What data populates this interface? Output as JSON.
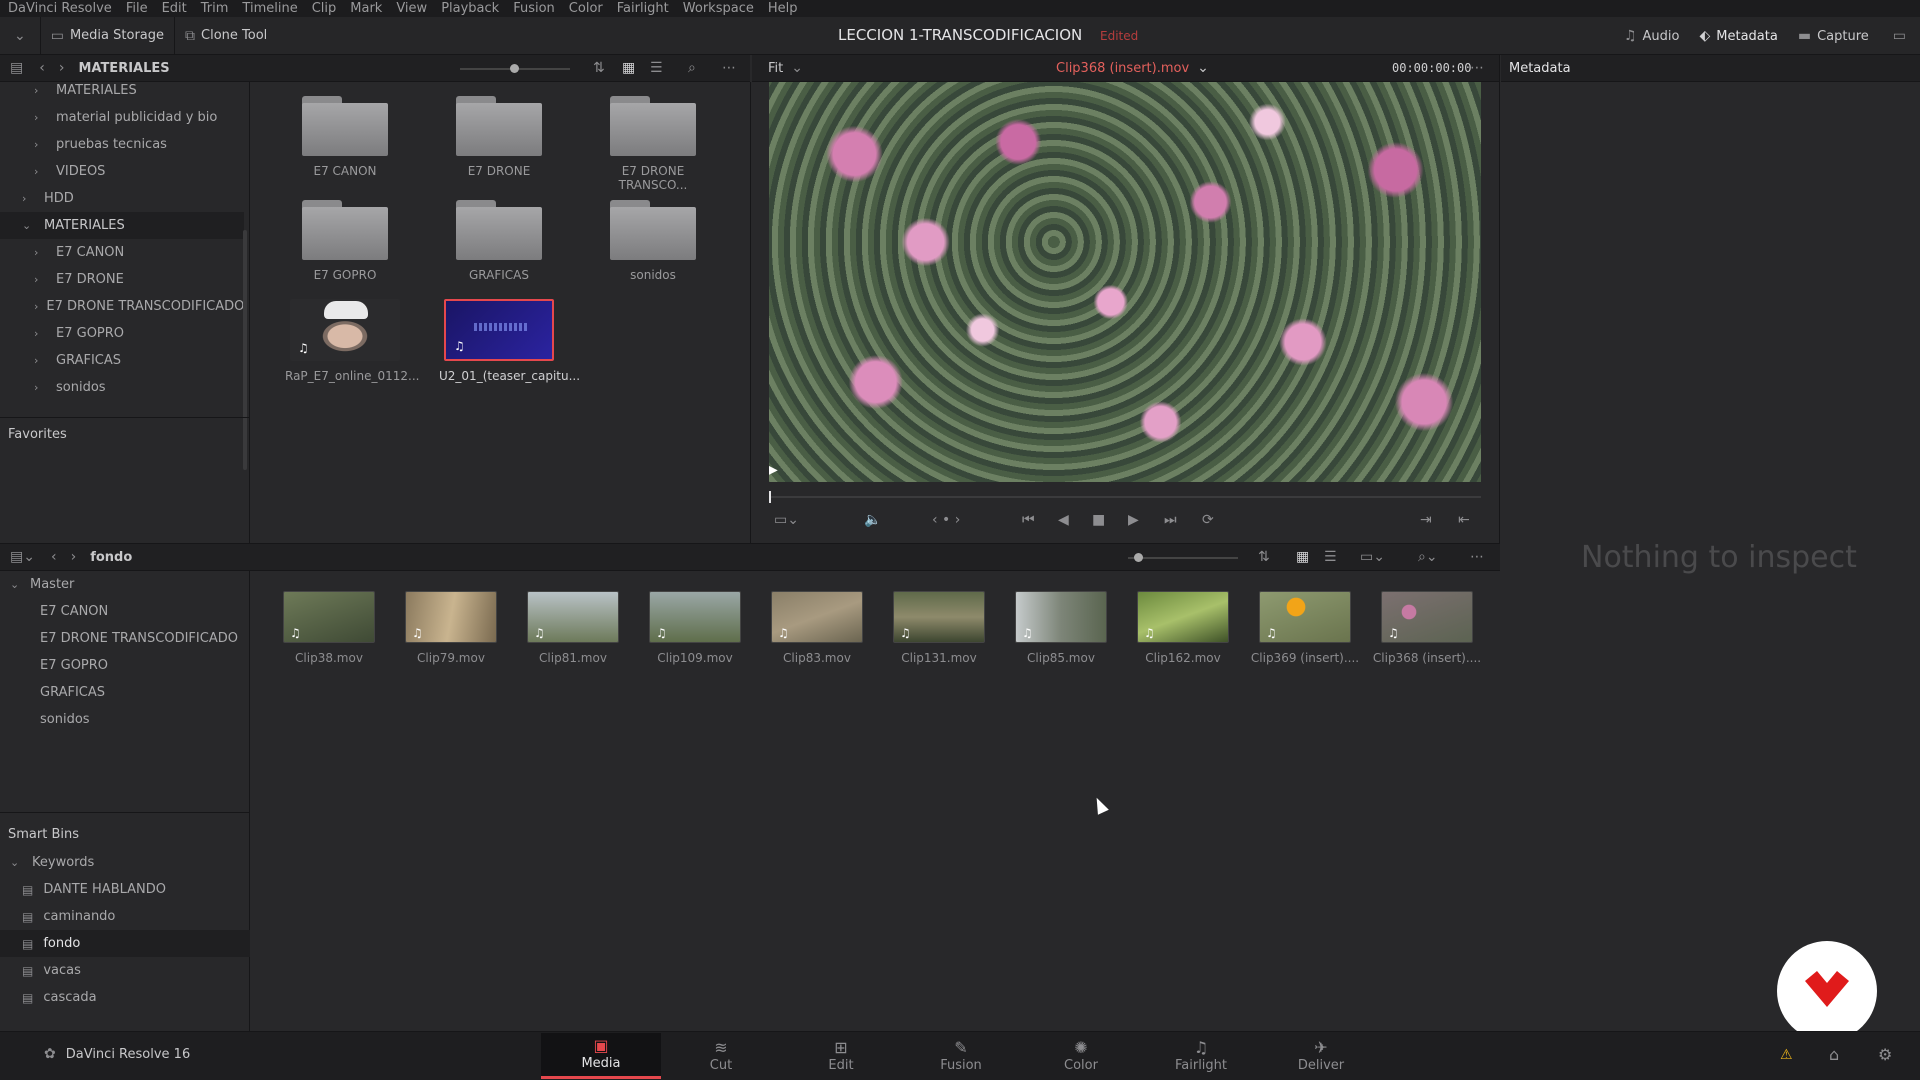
{
  "menu": [
    "DaVinci Resolve",
    "File",
    "Edit",
    "Trim",
    "Timeline",
    "Clip",
    "Mark",
    "View",
    "Playback",
    "Fusion",
    "Color",
    "Fairlight",
    "Workspace",
    "Help"
  ],
  "toolbar": {
    "media_storage": "Media Storage",
    "clone_tool": "Clone Tool",
    "project_title": "LECCION 1-TRANSCODIFICACION",
    "edited": "Edited",
    "audio": "Audio",
    "metadata": "Metadata",
    "capture": "Capture"
  },
  "storage": {
    "header": "MATERIALES",
    "tree": [
      {
        "label": "MATERIALES",
        "indent": 2,
        "caret": "›"
      },
      {
        "label": "material publicidad y bio",
        "indent": 2,
        "caret": "›"
      },
      {
        "label": "pruebas tecnicas",
        "indent": 2,
        "caret": "›"
      },
      {
        "label": "VIDEOS",
        "indent": 2,
        "caret": "›"
      },
      {
        "label": "HDD",
        "indent": 1,
        "caret": "›"
      },
      {
        "label": "MATERIALES",
        "indent": 1,
        "caret": "⌄",
        "selected": true
      },
      {
        "label": "E7 CANON",
        "indent": 2,
        "caret": "›"
      },
      {
        "label": "E7 DRONE",
        "indent": 2,
        "caret": "›"
      },
      {
        "label": "E7 DRONE TRANSCODIFICADO",
        "indent": 2,
        "caret": "›"
      },
      {
        "label": "E7 GOPRO",
        "indent": 2,
        "caret": "›"
      },
      {
        "label": "GRAFICAS",
        "indent": 2,
        "caret": "›"
      },
      {
        "label": "sonidos",
        "indent": 2,
        "caret": "›"
      }
    ],
    "favorites": "Favorites",
    "folders": [
      "E7 CANON",
      "E7 DRONE",
      "E7 DRONE TRANSCO...",
      "E7 GOPRO",
      "GRAFICAS",
      "sonidos"
    ],
    "files": [
      "RaP_E7_online_0112...",
      "U2_01_(teaser_capitu..."
    ]
  },
  "viewer": {
    "zoom": "Fit",
    "clip_name": "Clip368 (insert).mov",
    "timecode": "00:00:00:00"
  },
  "inspector": {
    "title": "Metadata",
    "empty_text": "Nothing to inspect"
  },
  "mediapool": {
    "bin_name": "fondo",
    "master": "Master",
    "bins": [
      "E7 CANON",
      "E7 DRONE TRANSCODIFICADO",
      "E7 GOPRO",
      "GRAFICAS",
      "sonidos"
    ],
    "clips": [
      "Clip38.mov",
      "Clip79.mov",
      "Clip81.mov",
      "Clip109.mov",
      "Clip83.mov",
      "Clip131.mov",
      "Clip85.mov",
      "Clip162.mov",
      "Clip369 (insert)....",
      "Clip368 (insert)...."
    ],
    "smart_bins": "Smart Bins",
    "keywords": "Keywords",
    "keyword_bins": [
      "DANTE HABLANDO",
      "caminando",
      "fondo",
      "vacas",
      "cascada"
    ]
  },
  "footer": {
    "app_version": "DaVinci Resolve 16",
    "pages": [
      "Media",
      "Cut",
      "Edit",
      "Fusion",
      "Color",
      "Fairlight",
      "Deliver"
    ],
    "active_page": "Media"
  },
  "colors": {
    "accent_red": "#e5484d",
    "edited": "#b53d3d",
    "clip_title": "#e3605c"
  }
}
